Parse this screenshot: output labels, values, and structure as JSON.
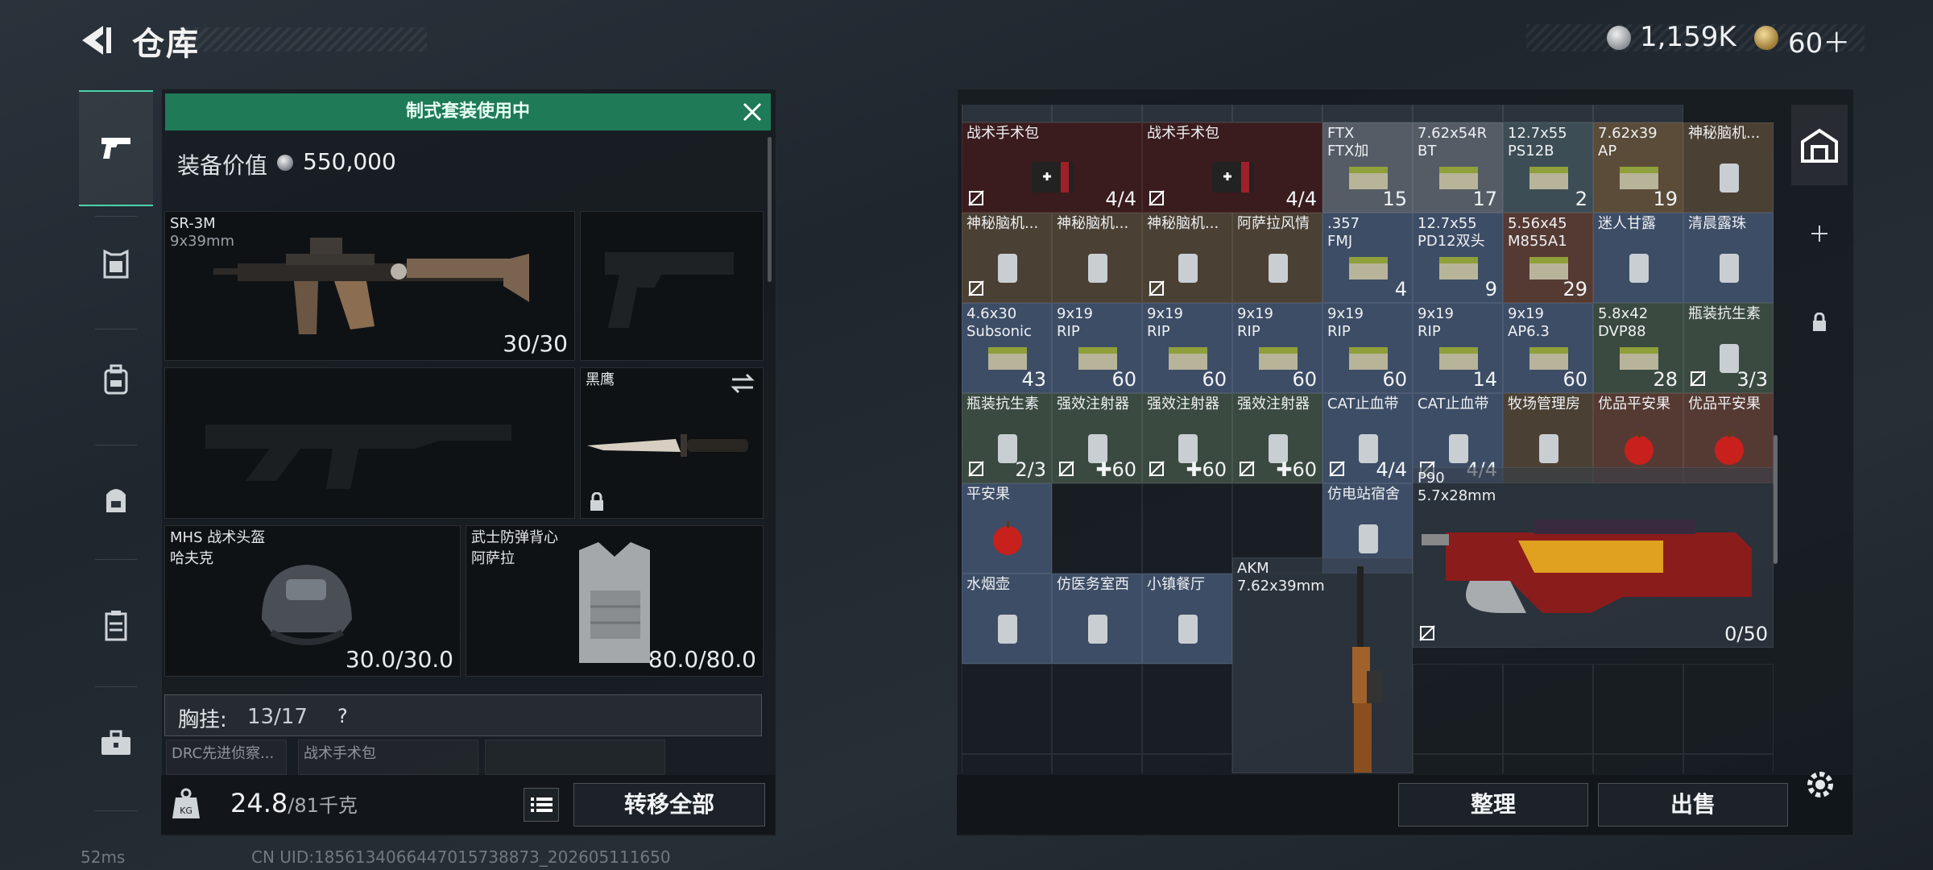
{
  "header": {
    "title": "仓库",
    "currency": "1,159K",
    "tickets": "60＋"
  },
  "leftnav": {
    "tabs": [
      "weapons",
      "armor",
      "backpack",
      "bag",
      "container",
      "toolbox"
    ]
  },
  "loadout": {
    "banner": "制式套装使用中",
    "gear_value_label": "装备价值",
    "gear_value": "550,000",
    "primary": {
      "name": "SR-3M",
      "sub": "9x39mm",
      "count": "30/30"
    },
    "melee": {
      "name": "黑鹰"
    },
    "helmet": {
      "name": "MHS 战术头盔",
      "sub": "哈夫克",
      "count": "30.0/30.0"
    },
    "armor": {
      "name": "武士防弹背心",
      "sub": "阿萨拉",
      "count": "80.0/80.0"
    },
    "chest": {
      "label": "胸挂:",
      "value": "13/17",
      "help": "?"
    },
    "peek": [
      "DRC先进侦察...",
      "战术手术包"
    ],
    "weight": "24.8",
    "weight_max": "/81千克",
    "transfer_all": "转移全部"
  },
  "storage": {
    "top_row": [
      "...",
      "战术手术包",
      "战术手术包",
      "FTX",
      "7.62x54R",
      "12.7x55",
      "7.62x39",
      "神秘脑机..."
    ],
    "cells": [
      {
        "name": "战术手术包",
        "count": "4/4",
        "locked": true
      },
      {
        "name": "战术手术包",
        "count": "4/4",
        "locked": true
      },
      {
        "name": "FTX\nFTX加",
        "count": "15"
      },
      {
        "name": "7.62x54R\nBT",
        "count": "17"
      },
      {
        "name": "12.7x55\nPS12B",
        "count": "2"
      },
      {
        "name": "7.62x39\nAP",
        "count": "19"
      },
      {
        "name": "神秘脑机...",
        "count": ""
      },
      {
        "name": "神秘脑机...",
        "count": "",
        "locked": true
      },
      {
        "name": "神秘脑机...",
        "count": ""
      },
      {
        "name": "神秘脑机...",
        "count": "",
        "locked": true
      },
      {
        "name": "阿萨拉风情",
        "count": ""
      },
      {
        "name": ".357\nFMJ",
        "count": "4"
      },
      {
        "name": "12.7x55\nPD12双头",
        "count": "9"
      },
      {
        "name": "5.56x45\nM855A1",
        "count": "29"
      },
      {
        "name": "迷人甘露",
        "count": ""
      },
      {
        "name": "清晨露珠",
        "count": ""
      },
      {
        "name": "4.6x30\nSubsonic",
        "count": "43"
      },
      {
        "name": "9x19\nRIP",
        "count": "60"
      },
      {
        "name": "9x19\nRIP",
        "count": "60"
      },
      {
        "name": "9x19\nRIP",
        "count": "60"
      },
      {
        "name": "9x19\nRIP",
        "count": "60"
      },
      {
        "name": "9x19\nRIP",
        "count": "14"
      },
      {
        "name": "9x19\nAP6.3",
        "count": "60"
      },
      {
        "name": "5.8x42\nDVP88",
        "count": "28"
      },
      {
        "name": "瓶装抗生素",
        "count": "3/3",
        "locked": true
      },
      {
        "name": "瓶装抗生素",
        "count": "2/3",
        "locked": true
      },
      {
        "name": "强效注射器",
        "count": "✚60",
        "locked": true
      },
      {
        "name": "强效注射器",
        "count": "✚60",
        "locked": true
      },
      {
        "name": "强效注射器",
        "count": "✚60",
        "locked": true
      },
      {
        "name": "CAT止血带",
        "count": "4/4",
        "locked": true
      },
      {
        "name": "CAT止血带",
        "count": "4/4",
        "locked": true
      },
      {
        "name": "牧场管理房",
        "count": ""
      },
      {
        "name": "优品平安果",
        "count": ""
      },
      {
        "name": "优品平安果",
        "count": ""
      },
      {
        "name": "平安果",
        "count": ""
      },
      {
        "name": "仿电站宿舍",
        "count": ""
      },
      {
        "name": "水烟壶",
        "count": ""
      },
      {
        "name": "仿医务室西",
        "count": ""
      },
      {
        "name": "小镇餐厅",
        "count": ""
      }
    ],
    "p90": {
      "name": "P90",
      "sub": "5.7x28mm",
      "count": "0/50"
    },
    "akm": {
      "name": "AKM",
      "sub": "7.62x39mm"
    },
    "sort": "整理",
    "sell": "出售"
  },
  "status": {
    "ping": "52ms",
    "uid": "CN UID:1856134066447015738873_202605111650"
  },
  "colors": {
    "accent": "#4bd3a9",
    "banner": "#1f7a57"
  }
}
